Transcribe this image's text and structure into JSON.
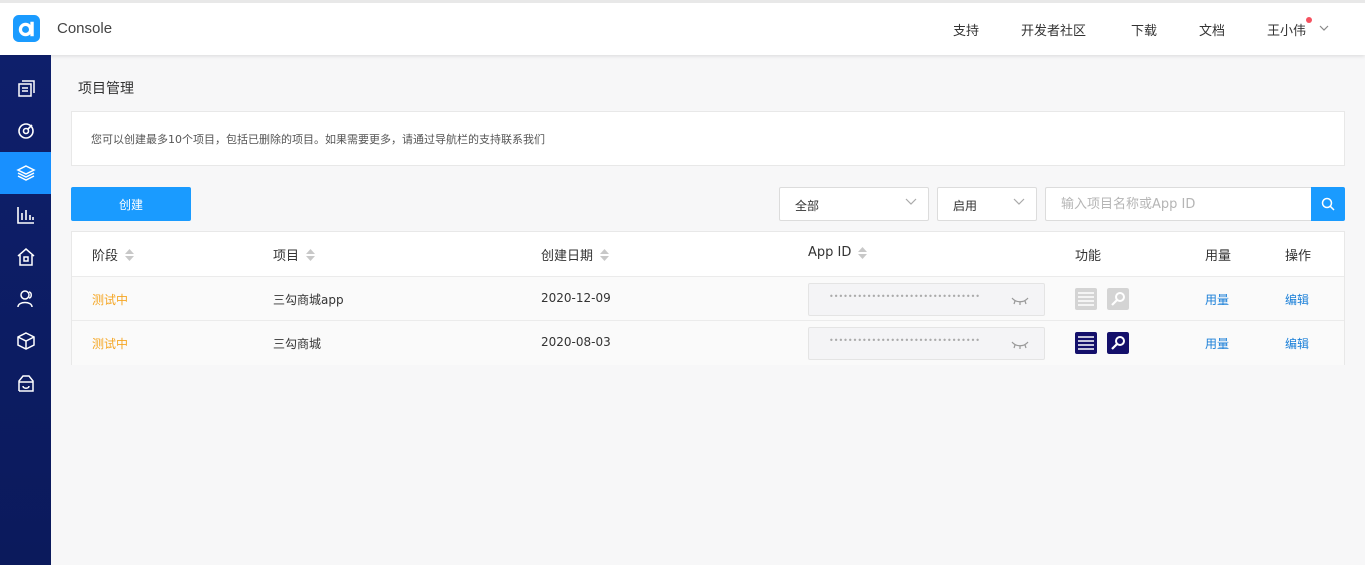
{
  "header": {
    "brand": "Console",
    "nav": [
      "支持",
      "开发者社区",
      "下载",
      "文档"
    ],
    "user": "王小伟"
  },
  "sidebar": {
    "items": [
      {
        "icon": "documents-icon",
        "active": false
      },
      {
        "icon": "target-icon",
        "active": false
      },
      {
        "icon": "layers-icon",
        "active": true
      },
      {
        "icon": "bar-chart-icon",
        "active": false
      },
      {
        "icon": "home-shield-icon",
        "active": false
      },
      {
        "icon": "users-icon",
        "active": false
      },
      {
        "icon": "cube-icon",
        "active": false
      },
      {
        "icon": "cloud-box-icon",
        "active": false
      }
    ]
  },
  "page": {
    "title": "项目管理",
    "notice": "您可以创建最多10个项目，包括已删除的项目。如果需要更多，请通过导航栏的支持联系我们"
  },
  "toolbar": {
    "create_label": "创建",
    "filter_all": "全部",
    "filter_status": "启用",
    "search_placeholder": "输入项目名称或App ID"
  },
  "table": {
    "headers": {
      "stage": "阶段",
      "project": "项目",
      "created": "创建日期",
      "appid": "App ID",
      "features": "功能",
      "usage": "用量",
      "actions": "操作"
    },
    "rows": [
      {
        "stage": "测试中",
        "project": "三勾商城app",
        "created": "2020-12-09",
        "appid_masked": "••••••••••••••••••••••••••••••••",
        "features_enabled": false,
        "usage": "用量",
        "action": "编辑"
      },
      {
        "stage": "测试中",
        "project": "三勾商城",
        "created": "2020-08-03",
        "appid_masked": "••••••••••••••••••••••••••••••••",
        "features_enabled": true,
        "usage": "用量",
        "action": "编辑"
      }
    ]
  },
  "colors": {
    "accent": "#1a9bff",
    "sidebar": "#0e1f6b",
    "status": "#f5a623",
    "link": "#1a7fd8",
    "feature_on": "#14106b",
    "feature_off": "#d4d4d4"
  }
}
